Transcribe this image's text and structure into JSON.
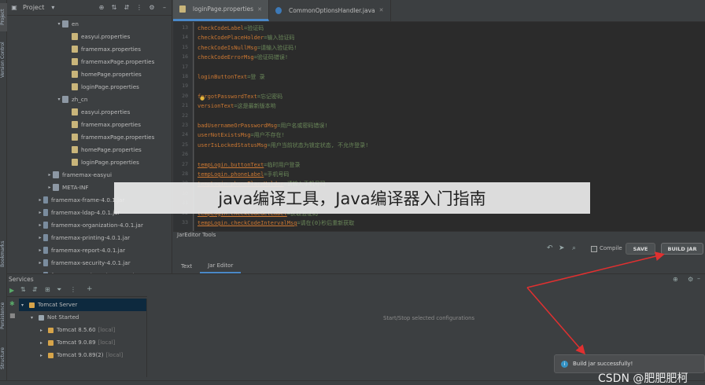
{
  "left_strip": {
    "tabs": [
      "Project",
      "Version Control",
      "Bookmarks",
      "Persistence",
      "Structure"
    ]
  },
  "project_panel": {
    "title": "Project",
    "tree": [
      {
        "label": "en",
        "type": "folder",
        "depth": 5,
        "expanded": true
      },
      {
        "label": "easyui.properties",
        "type": "prop",
        "depth": 6
      },
      {
        "label": "framemax.properties",
        "type": "prop",
        "depth": 6
      },
      {
        "label": "framemaxPage.properties",
        "type": "prop",
        "depth": 6
      },
      {
        "label": "homePage.properties",
        "type": "prop",
        "depth": 6
      },
      {
        "label": "loginPage.properties",
        "type": "prop",
        "depth": 6
      },
      {
        "label": "zh_cn",
        "type": "folder",
        "depth": 5,
        "expanded": true
      },
      {
        "label": "easyui.properties",
        "type": "prop",
        "depth": 6
      },
      {
        "label": "framemax.properties",
        "type": "prop",
        "depth": 6
      },
      {
        "label": "framemaxPage.properties",
        "type": "prop",
        "depth": 6
      },
      {
        "label": "homePage.properties",
        "type": "prop",
        "depth": 6
      },
      {
        "label": "loginPage.properties",
        "type": "prop",
        "depth": 6
      },
      {
        "label": "framemax-easyui",
        "type": "folder",
        "depth": 4,
        "expanded": false
      },
      {
        "label": "META-INF",
        "type": "folder",
        "depth": 4,
        "expanded": false
      },
      {
        "label": "framemax-frame-4.0.1.jar",
        "type": "jar",
        "depth": 3,
        "expanded": false
      },
      {
        "label": "framemax-ldap-4.0.1.jar",
        "type": "jar",
        "depth": 3,
        "expanded": false
      },
      {
        "label": "framemax-organization-4.0.1.jar",
        "type": "jar",
        "depth": 3,
        "expanded": false
      },
      {
        "label": "framemax-printing-4.0.1.jar",
        "type": "jar",
        "depth": 3,
        "expanded": false
      },
      {
        "label": "framemax-report-4.0.1.jar",
        "type": "jar",
        "depth": 3,
        "expanded": false
      },
      {
        "label": "framemax-security-4.0.1.jar",
        "type": "jar",
        "depth": 3,
        "expanded": false
      },
      {
        "label": "framemax-webservice-4.0.1.jar",
        "type": "jar",
        "depth": 3,
        "expanded": false
      }
    ]
  },
  "editor": {
    "tabs": [
      {
        "label": "loginPage.properties",
        "active": true
      },
      {
        "label": "CommonOptionsHandler.java",
        "active": false
      }
    ],
    "lines": [
      {
        "n": "13",
        "key": "checkCodeLabel",
        "val": "=验证码",
        "u": false
      },
      {
        "n": "14",
        "key": "checkCodePlaceHolder",
        "val": "=输入验证码",
        "u": false
      },
      {
        "n": "15",
        "key": "checkCodeIsNullMsg",
        "val": "=请输入验证码!",
        "u": false
      },
      {
        "n": "16",
        "key": "checkCodeErrorMsg",
        "val": "=验证码错误!",
        "u": false
      },
      {
        "n": "17",
        "key": "",
        "val": "",
        "u": false
      },
      {
        "n": "18",
        "key": "loginButtonText",
        "val": "=登 录",
        "u": false
      },
      {
        "n": "19",
        "key": "",
        "val": "",
        "u": false
      },
      {
        "n": "20",
        "key": "forgotPasswordText",
        "val": "=忘记密码",
        "u": false
      },
      {
        "n": "21",
        "key": "versionText",
        "val": "=这是最新版本哟",
        "u": false
      },
      {
        "n": "22",
        "key": "",
        "val": "",
        "u": false
      },
      {
        "n": "23",
        "key": "badUsernameOrPasswordMsg",
        "val": "=用户名或密码错误!",
        "u": false
      },
      {
        "n": "24",
        "key": "userNotExistsMsg",
        "val": "=用户不存在!",
        "u": false
      },
      {
        "n": "25",
        "key": "userIsLockedStatusMsg",
        "val": "=用户当前状态为锁定状态, 不允许登录!",
        "u": false
      },
      {
        "n": "26",
        "key": "",
        "val": "",
        "u": false
      },
      {
        "n": "27",
        "key": "tempLogin.buttonText",
        "val": "=临时用户登录",
        "u": true
      },
      {
        "n": "28",
        "key": "tempLogin.phoneLabel",
        "val": "=手机号码",
        "u": true
      },
      {
        "n": "29",
        "key": "tempLogin.phonePlaceHolder",
        "val": "=请输入手机号码",
        "u": true
      },
      {
        "n": "30",
        "key": "",
        "val": "",
        "u": false
      },
      {
        "n": "31",
        "key": "",
        "val": "",
        "u": false
      },
      {
        "n": "32",
        "key": "tempLogin.checkCodeGetLabel",
        "val": "=获取验证码",
        "u": true
      },
      {
        "n": "33",
        "key": "tempLogin.checkCodeIntervalMsg",
        "val": "=请在{0}秒后重新获取",
        "u": true
      }
    ]
  },
  "jar_panel": {
    "title": "JarEditor Tools",
    "compile_label": "Compile",
    "save_label": "SAVE",
    "build_label": "BUILD JAR",
    "bottom_tabs": [
      {
        "label": "Text",
        "active": false
      },
      {
        "label": "Jar Editor",
        "active": true
      }
    ]
  },
  "services": {
    "title": "Services",
    "empty_text": "Start/Stop selected configurations",
    "items": [
      {
        "label": "Tomcat Server",
        "suffix": "",
        "depth": 0,
        "selected": true
      },
      {
        "label": "Not Started",
        "suffix": "",
        "depth": 1,
        "selected": false
      },
      {
        "label": "Tomcat 8.5.60",
        "suffix": "[local]",
        "depth": 2,
        "selected": false
      },
      {
        "label": "Tomcat 9.0.89",
        "suffix": "[local]",
        "depth": 2,
        "selected": false
      },
      {
        "label": "Tomcat 9.0.89(2)",
        "suffix": "[local]",
        "depth": 2,
        "selected": false
      }
    ]
  },
  "notification": {
    "text": "Build jar successfully!"
  },
  "banner": {
    "text": "java编译工具，Java编译器入门指南"
  },
  "watermark": {
    "text": "CSDN @肥肥肥柯"
  },
  "colors": {
    "accent": "#4a88c7",
    "arrow": "#e03030",
    "key": "#cc7832",
    "value": "#6a8759"
  }
}
